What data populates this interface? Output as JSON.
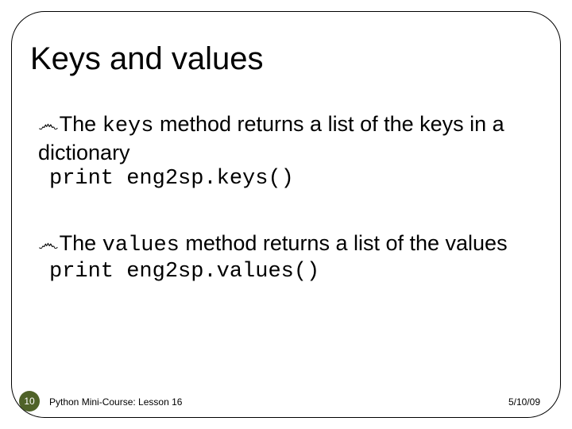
{
  "title": "Keys and values",
  "items": [
    {
      "pre": "The ",
      "code_inline": "keys",
      "post": " method returns a list of the keys in a dictionary",
      "code_line": "print eng2sp.keys()"
    },
    {
      "pre": "The ",
      "code_inline": "values",
      "post": " method returns a list of the values",
      "code_line": "print eng2sp.values()"
    }
  ],
  "footer": {
    "page": "10",
    "course": "Python Mini-Course: Lesson 16",
    "date": "5/10/09"
  },
  "bullet_glyph": "෴"
}
